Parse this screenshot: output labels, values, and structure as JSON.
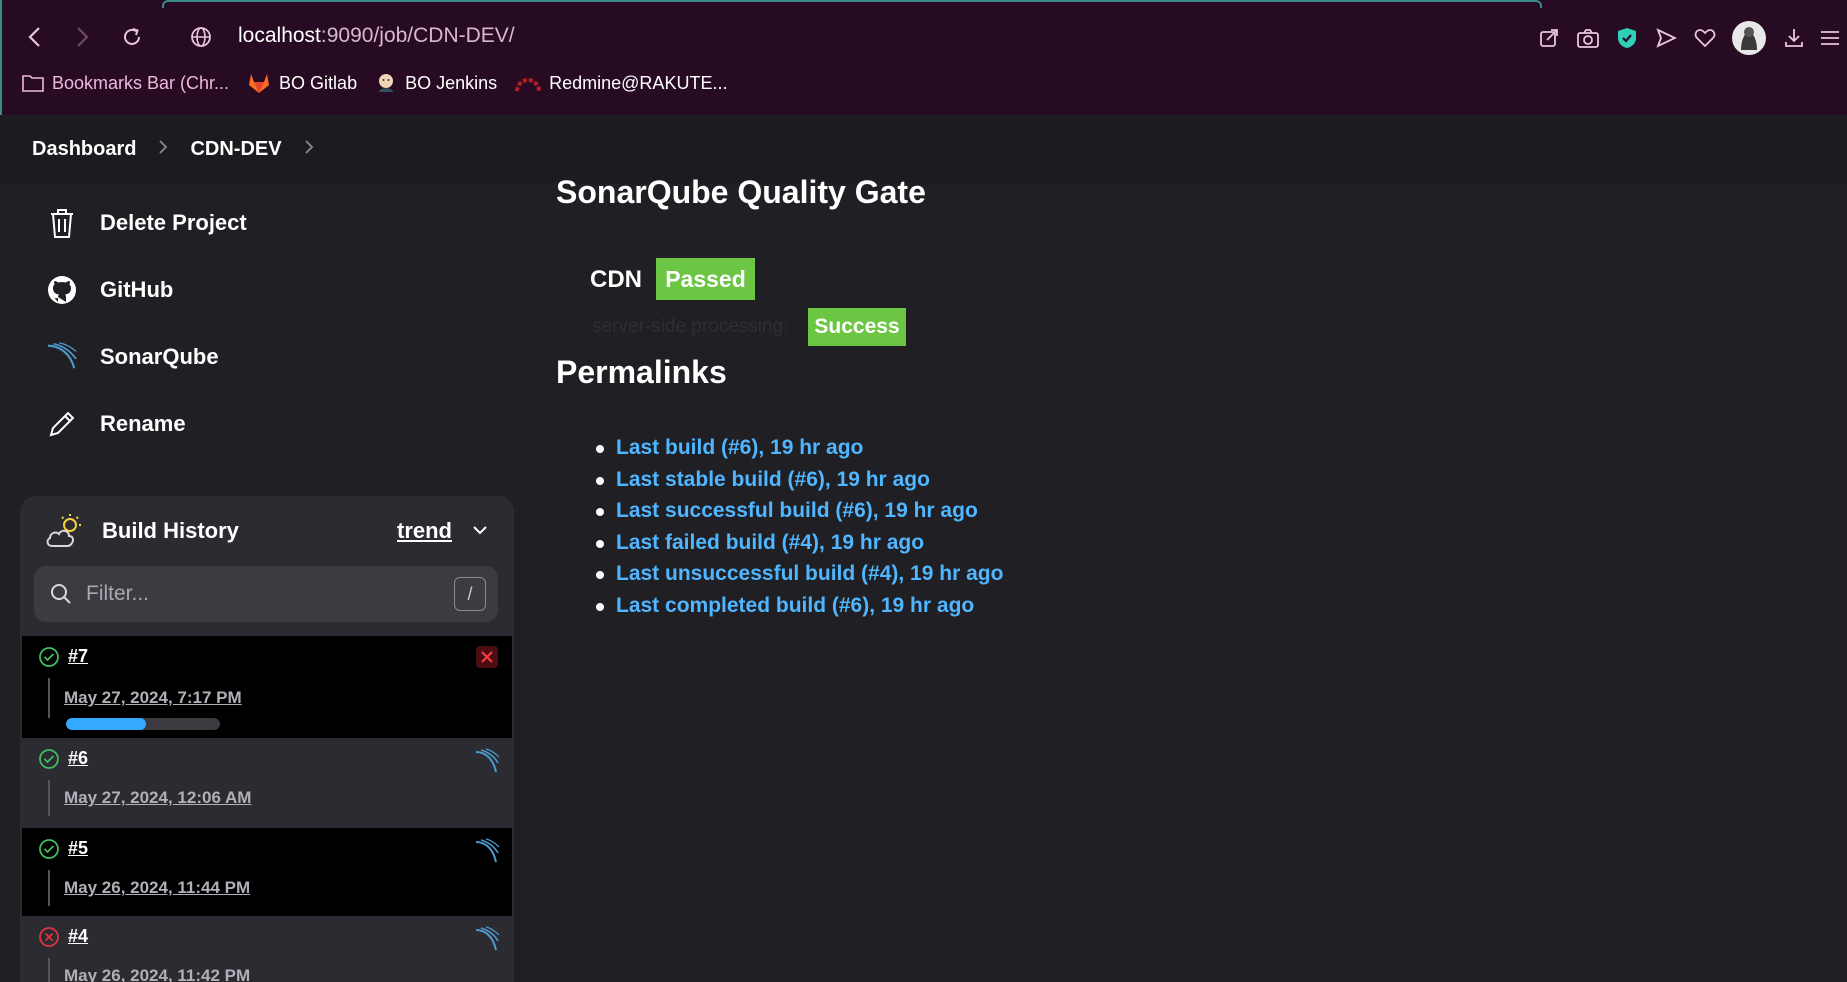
{
  "browser": {
    "url_host": "localhost",
    "url_rest": ":9090/job/CDN-DEV/",
    "bookmarks": [
      {
        "label": "Bookmarks Bar (Chr...",
        "icon": "folder-icon"
      },
      {
        "label": "BO Gitlab",
        "icon": "gitlab-icon"
      },
      {
        "label": "BO Jenkins",
        "icon": "jenkins-icon"
      },
      {
        "label": "Redmine@RAKUTE...",
        "icon": "redmine-icon"
      }
    ],
    "toolbar_icons": [
      "share-icon",
      "camera-icon",
      "shield-icon",
      "send-icon",
      "heart-icon",
      "profile-avatar",
      "download-icon",
      "menu-icon"
    ]
  },
  "breadcrumb": {
    "items": [
      "Dashboard",
      "CDN-DEV"
    ]
  },
  "sidebar": {
    "items": [
      {
        "label": "Delete Project",
        "icon": "trash-icon"
      },
      {
        "label": "GitHub",
        "icon": "github-icon"
      },
      {
        "label": "SonarQube",
        "icon": "sonarqube-icon"
      },
      {
        "label": "Rename",
        "icon": "pencil-icon"
      }
    ]
  },
  "build_history": {
    "title": "Build History",
    "trend_label": "trend",
    "filter_placeholder": "Filter...",
    "shortcut_key": "/",
    "builds": [
      {
        "number": "#7",
        "date": "May 27, 2024, 7:17 PM",
        "status": "success",
        "in_progress": true,
        "progress": 0.52,
        "action": "cancel"
      },
      {
        "number": "#6",
        "date": "May 27, 2024, 12:06 AM",
        "status": "success",
        "action": "sonarqube"
      },
      {
        "number": "#5",
        "date": "May 26, 2024, 11:44 PM",
        "status": "success",
        "action": "sonarqube"
      },
      {
        "number": "#4",
        "date": "May 26, 2024, 11:42 PM",
        "status": "failed",
        "action": "sonarqube"
      }
    ]
  },
  "sonarqube": {
    "title": "SonarQube Quality Gate",
    "project": "CDN",
    "gate_status": "Passed",
    "server_side_label": "server-side processing:",
    "server_side_status": "Success"
  },
  "permalinks": {
    "title": "Permalinks",
    "links": [
      "Last build (#6), 19 hr ago",
      "Last stable build (#6), 19 hr ago",
      "Last successful build (#6), 19 hr ago",
      "Last failed build (#4), 19 hr ago",
      "Last unsuccessful build (#4), 19 hr ago",
      "Last completed build (#6), 19 hr ago"
    ]
  },
  "colors": {
    "chrome_bg": "#270b22",
    "page_bg": "#1f1f24",
    "badge_green": "#6cc644",
    "link_blue": "#4fb6ff",
    "progress_blue": "#35a9ff"
  }
}
